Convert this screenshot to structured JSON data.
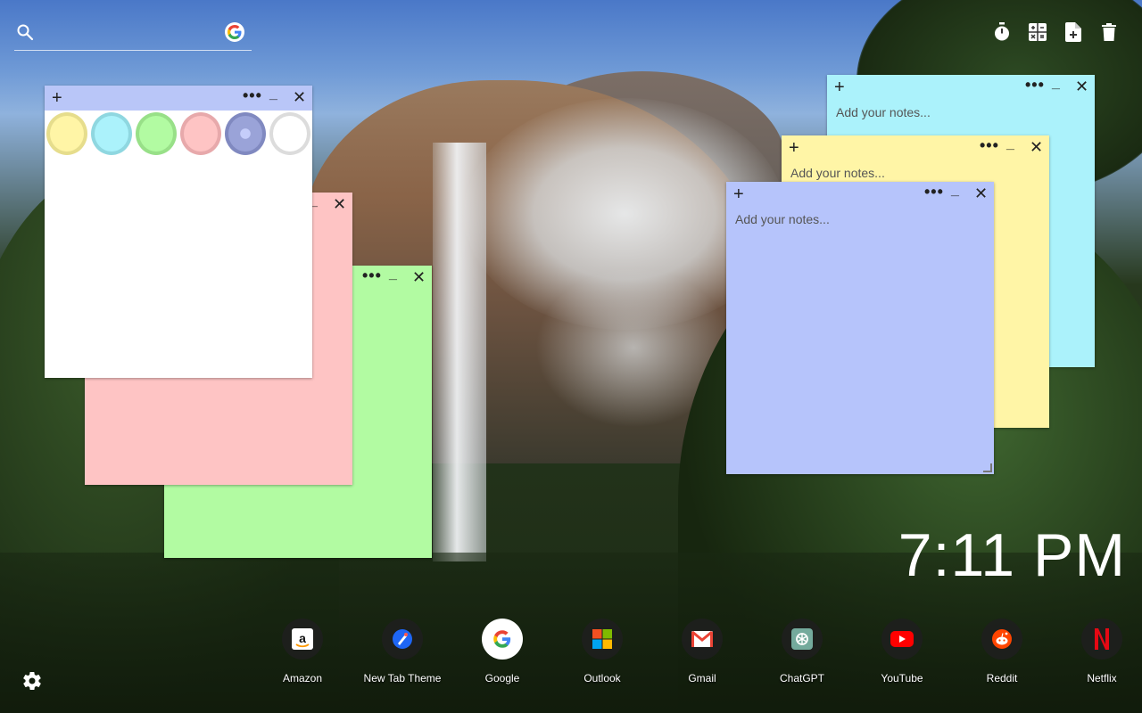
{
  "search": {
    "placeholder": "",
    "search_icon": "search-icon",
    "engine_icon": "google-g-icon"
  },
  "top_icons": [
    "timer-icon",
    "calculator-icon",
    "new-note-icon",
    "trash-icon"
  ],
  "notes": {
    "plus": "+",
    "dots": "•••",
    "minimize": "_",
    "close": "✕",
    "placeholder": "Add your notes..."
  },
  "palette": {
    "swatches": [
      "#f7ef9a",
      "#a9eff7",
      "#aef2a0",
      "#f8b9bd",
      "#9aa3d8",
      "#eeeeee"
    ]
  },
  "colors": {
    "yellow": "#fff5a6",
    "cyan": "#abf2fb",
    "blue": "#b6c4fb",
    "pink": "#fec4c4",
    "green": "#b2fba2",
    "white": "#ffffff",
    "white_header": "#b9c6f8"
  },
  "clock": {
    "time": "7:11 PM"
  },
  "dock": {
    "apps": [
      {
        "label": "Amazon",
        "icon": "amazon-icon"
      },
      {
        "label": "New Tab Theme",
        "icon": "new-tab-theme-icon"
      },
      {
        "label": "Google",
        "icon": "google-icon"
      },
      {
        "label": "Outlook",
        "icon": "outlook-icon"
      },
      {
        "label": "Gmail",
        "icon": "gmail-icon"
      },
      {
        "label": "ChatGPT",
        "icon": "chatgpt-icon"
      },
      {
        "label": "YouTube",
        "icon": "youtube-icon"
      },
      {
        "label": "Reddit",
        "icon": "reddit-icon"
      },
      {
        "label": "Netflix",
        "icon": "netflix-icon"
      }
    ]
  },
  "settings": {
    "icon": "gear-icon"
  }
}
